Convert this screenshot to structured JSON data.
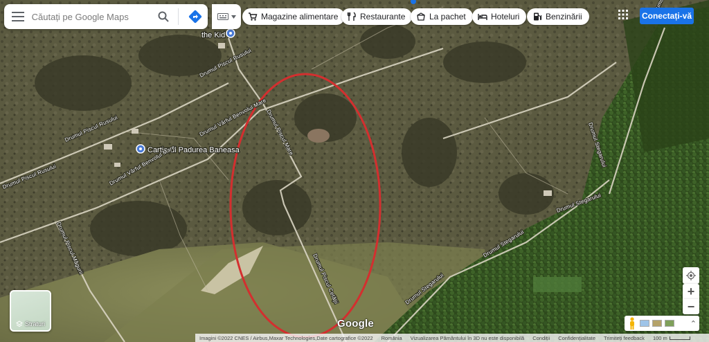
{
  "search": {
    "placeholder": "Căutați pe Google Maps"
  },
  "icons": {
    "menu": "hamburger-menu-icon",
    "search": "search-icon",
    "directions": "directions-icon",
    "keyboard": "keyboard-icon",
    "apps": "apps-grid-icon",
    "layers": "layers-icon",
    "locate": "my-location-icon",
    "pegman": "pegman-icon"
  },
  "chips": [
    {
      "label": "Magazine alimentare",
      "icon": "cart-icon"
    },
    {
      "label": "Restaurante",
      "icon": "fork-knife-icon"
    },
    {
      "label": "La pachet",
      "icon": "takeout-icon"
    },
    {
      "label": "Hoteluri",
      "icon": "bed-icon"
    },
    {
      "label": "Benzinării",
      "icon": "fuel-icon"
    }
  ],
  "signin": {
    "label": "Conectați-vă"
  },
  "map": {
    "places": [
      {
        "name": "the Kid"
      },
      {
        "name": "Cartierul Padurea Baneasa"
      }
    ],
    "roads": {
      "rusului_1": "Drumul Piscul Rusului",
      "rusului_2": "Drumul Piscul Rusului",
      "rusului_3": "Drumul Piscul Rusului",
      "benvolul_1": "Drumul Vârful Benvolul Mare",
      "benvolul_2": "Drumul Vârful Benvolul Mare",
      "piscul_mare": "Drumul Piscul Mare",
      "piscul_cetatii": "Drumul Piscul Cetății",
      "piscul_magurii": "Drumul Piscul Măgurii",
      "stegaruluui_1": "Drumul Stegarului",
      "stegaruluui_2": "Drumul Stegarului",
      "stegaruluui_3": "Drumul Stegarului",
      "stegaruluui_4": "Drumul Stegarului",
      "top_partial": "Drumul ... Ene"
    },
    "annotation_color": "#d32f2f",
    "brand": "Google"
  },
  "layers": {
    "label": "Straturi"
  },
  "controls": {
    "zoom_in": "+",
    "zoom_out": "−",
    "expand": "⌃"
  },
  "footer": {
    "attribution": "Imagini ©2022 CNES / Airbus,Maxar Technologies,Date cartografice ©2022",
    "country": "România",
    "earth_3d": "Vizualizarea Pământului în 3D nu este disponibilă",
    "terms": "Condiții",
    "privacy": "Confidențialitate",
    "feedback": "Trimiteți feedback",
    "scale": "100 m"
  }
}
